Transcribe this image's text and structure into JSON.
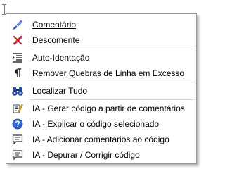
{
  "menu": {
    "items": [
      {
        "label": "Comentário",
        "icon": "comment-brush-icon"
      },
      {
        "label": "Descomente",
        "icon": "uncomment-brush-icon"
      },
      {
        "label": "Auto-Identação",
        "icon": "indent-icon"
      },
      {
        "label": "Remover Quebras de Linha em Excesso",
        "icon": "pilcrow-icon"
      },
      {
        "label": "Localizar Tudo",
        "icon": "binoculars-icon"
      },
      {
        "label": "IA - Gerar código a partir de comentários",
        "icon": "ai-generate-icon"
      },
      {
        "label": "IA - Explicar o código selecionado",
        "icon": "ai-explain-icon"
      },
      {
        "label": "IA - Adicionar comentários ao código",
        "icon": "ai-comment-icon"
      },
      {
        "label": "IA - Depurar / Corrigir código",
        "icon": "ai-debug-icon"
      }
    ]
  },
  "colors": {
    "border": "#979797",
    "separator": "#d7d7d7",
    "text": "#000000",
    "icon_blue": "#2f5fb8",
    "icon_red": "#d02020"
  }
}
